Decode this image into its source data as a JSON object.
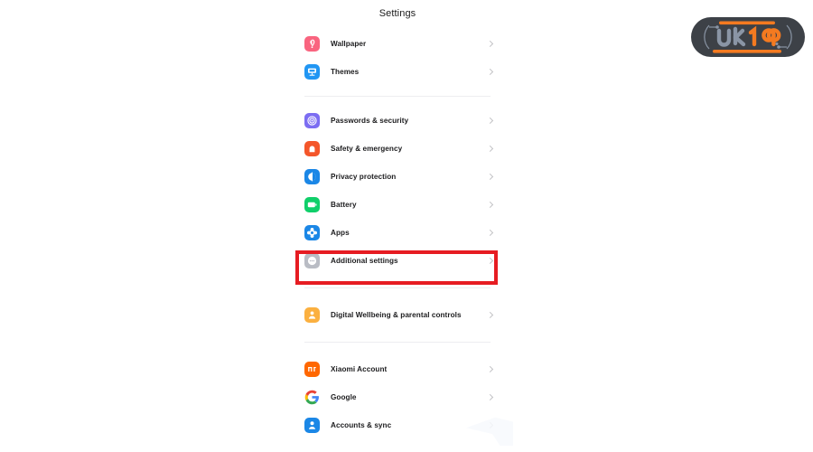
{
  "screen": {
    "title": "Settings"
  },
  "groups": [
    {
      "name": "appearance",
      "items": [
        {
          "label": "Wallpaper",
          "icon": "wallpaper-icon",
          "color": "#f9647f"
        },
        {
          "label": "Themes",
          "icon": "themes-icon",
          "color": "#2196f3"
        }
      ]
    },
    {
      "name": "security-and-system",
      "items": [
        {
          "label": "Passwords & security",
          "icon": "fingerprint-icon",
          "color": "#7c6df2"
        },
        {
          "label": "Safety & emergency",
          "icon": "emergency-icon",
          "color": "#f4562a"
        },
        {
          "label": "Privacy protection",
          "icon": "privacy-shield-icon",
          "color": "#1b87e6"
        },
        {
          "label": "Battery",
          "icon": "battery-icon",
          "color": "#10cf6a"
        },
        {
          "label": "Apps",
          "icon": "apps-icon",
          "color": "#1b87e6"
        },
        {
          "label": "Additional settings",
          "icon": "more-dots-icon",
          "color": "#b9bcc4"
        }
      ]
    },
    {
      "name": "wellbeing",
      "items": [
        {
          "label": "Digital Wellbeing & parental controls",
          "icon": "wellbeing-person-icon",
          "color": "#fbb040"
        }
      ]
    },
    {
      "name": "accounts",
      "items": [
        {
          "label": "Xiaomi Account",
          "icon": "xiaomi-logo-icon",
          "color": "#ff6700"
        },
        {
          "label": "Google",
          "icon": "google-logo-icon",
          "color": "#ffffff"
        },
        {
          "label": "Accounts & sync",
          "icon": "account-person-icon",
          "color": "#1b87e6"
        }
      ]
    }
  ],
  "highlight": {
    "target_label": "Additional settings",
    "border_color": "#e61c22"
  },
  "watermark": {
    "text_primary": "UR",
    "text_secondary": "19",
    "body_color": "#3d4147",
    "primary_color": "#8a95a5",
    "accent_color": "#f47a20"
  }
}
